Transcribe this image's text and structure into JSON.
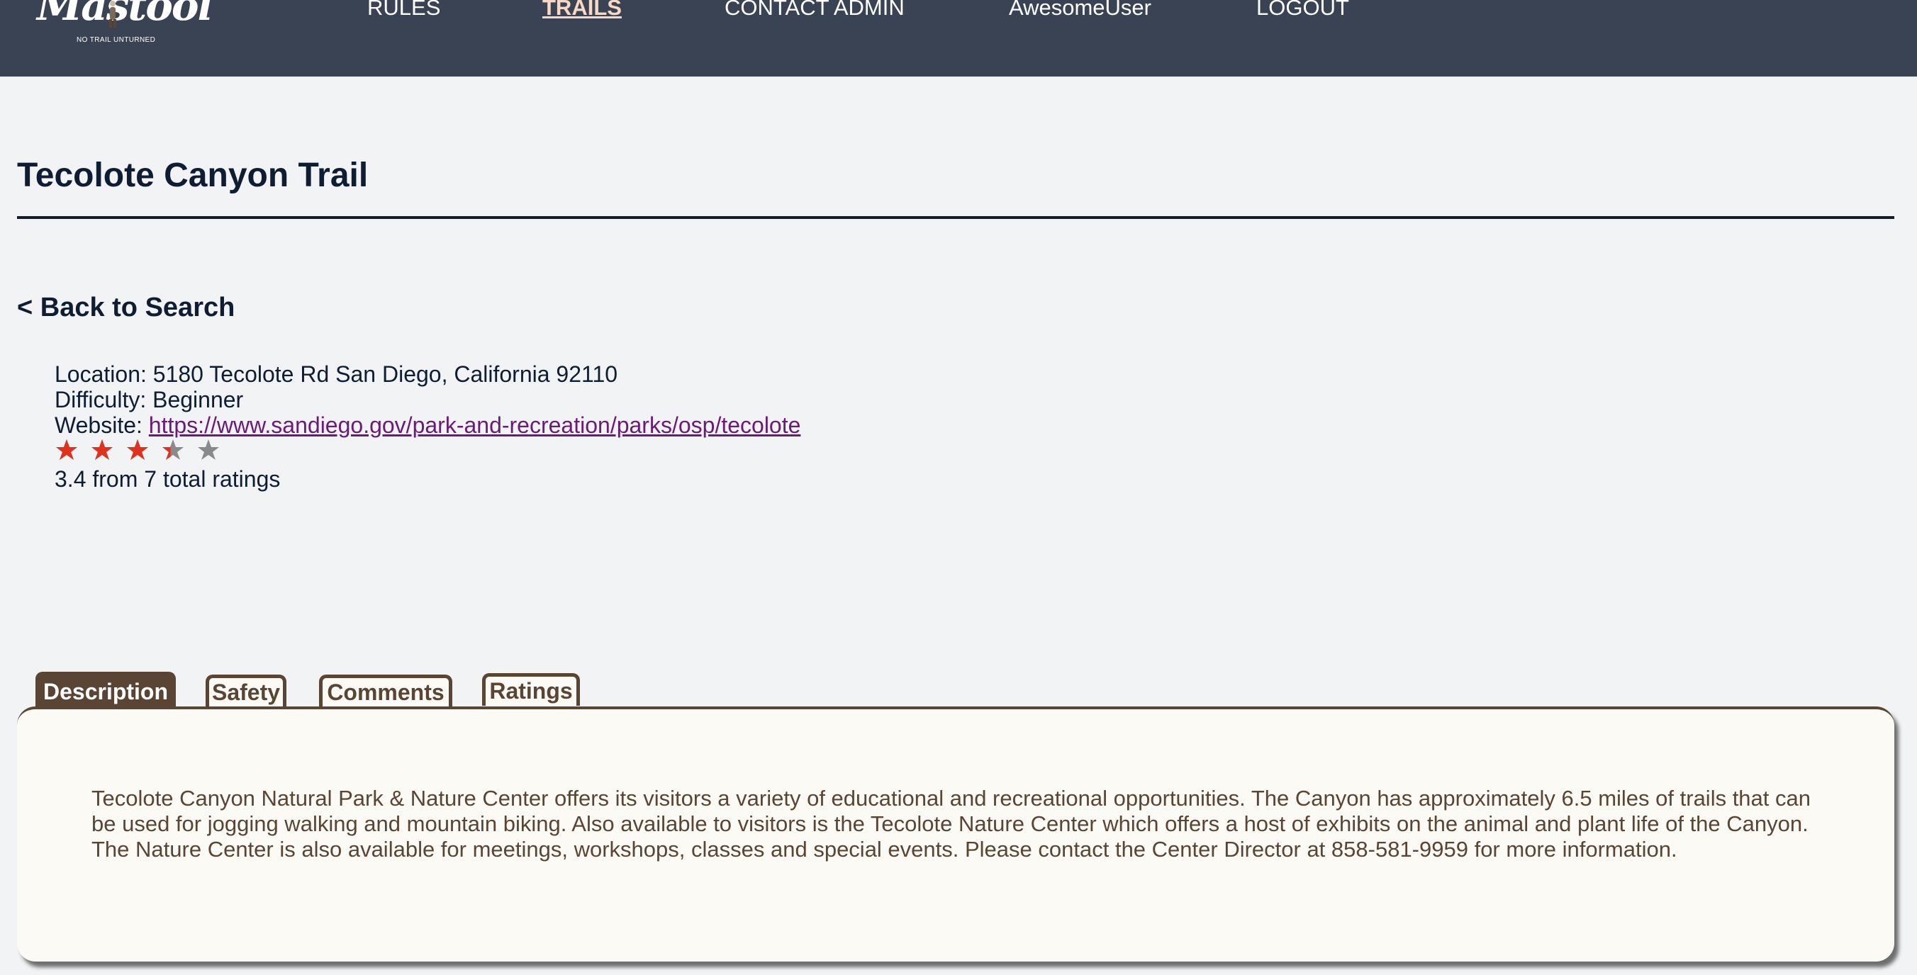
{
  "header": {
    "logo_text": "Mastool",
    "logo_tagline": "NO TRAIL UNTURNED",
    "nav": {
      "rules": "RULES",
      "trails": "TRAILS",
      "contact": "CONTACT ADMIN",
      "user": "AwesomeUser",
      "logout": "LOGOUT"
    }
  },
  "trail": {
    "title": "Tecolote Canyon Trail",
    "back_label": "< Back to Search",
    "location_label": "Location:",
    "location_value": "5180 Tecolote Rd San Diego, California 92110",
    "difficulty_label": "Difficulty:",
    "difficulty_value": "Beginner",
    "website_label": "Website:",
    "website_url": "https://www.sandiego.gov/park-and-recreation/parks/osp/tecolote",
    "rating_value": 3.4,
    "rating_max": 5,
    "rating_summary": "3.4 from 7 total ratings"
  },
  "tabs": {
    "description": "Description",
    "safety": "Safety",
    "comments": "Comments",
    "ratings": "Ratings",
    "active": "description"
  },
  "description_text": "Tecolote Canyon Natural Park & Nature Center offers its visitors a variety of educational and recreational opportunities. The Canyon has approximately 6.5 miles of trails that can be used for jogging walking and mountain biking. Also available to visitors is the Tecolote Nature Center which offers a host of exhibits on the animal and plant life of the Canyon. The Nature Center is also available for meetings, workshops, classes and special events. Please contact the Center Director at 858-581-9959 for more information.",
  "colors": {
    "nav_bg": "#3a4354",
    "star_filled": "#e0301e",
    "star_empty": "#8a8a8a",
    "tab_brown": "#5a4535",
    "link_purple": "#6b1a79"
  }
}
